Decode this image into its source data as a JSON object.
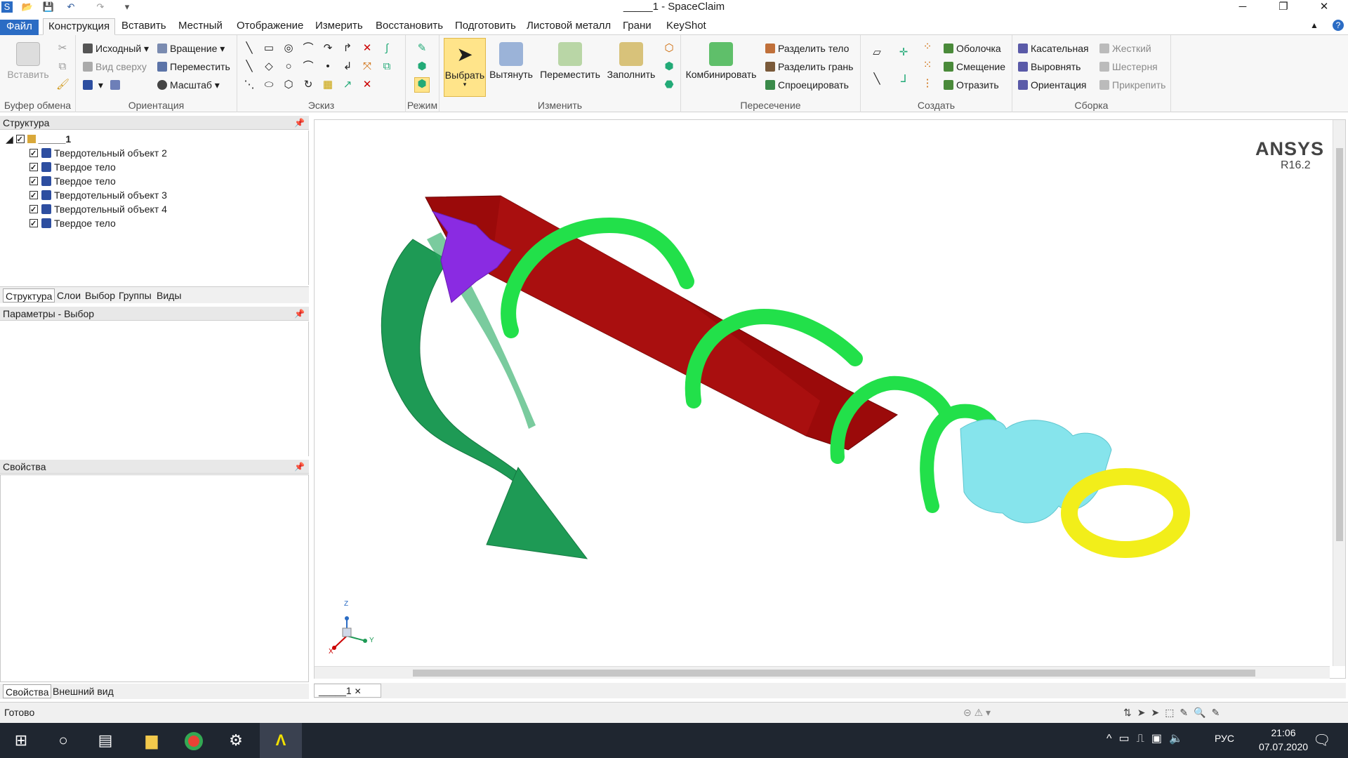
{
  "window": {
    "title": "_____1 - SpaceClaim"
  },
  "menu": {
    "file": "Файл",
    "tabs": [
      "Конструкция",
      "Вставить",
      "Местный",
      "Отображение",
      "Измерить",
      "Восстановить",
      "Подготовить",
      "Листовой металл",
      "Грани",
      "KeyShot"
    ]
  },
  "ribbon": {
    "clipboard": {
      "paste": "Вставить",
      "label": "Буфер обмена"
    },
    "orientation": {
      "home": "Исходный",
      "rotate": "Вращение",
      "top_view": "Вид сверху",
      "pan": "Переместить",
      "zoom": "Масштаб",
      "label": "Ориентация"
    },
    "sketch": {
      "label": "Эскиз"
    },
    "mode": {
      "label": "Режим"
    },
    "edit": {
      "select": "Выбрать",
      "pull": "Вытянуть",
      "move": "Переместить",
      "fill": "Заполнить",
      "label": "Изменить"
    },
    "intersect": {
      "combine": "Комбинировать",
      "split_body": "Разделить тело",
      "split_face": "Разделить грань",
      "project": "Спроецировать",
      "label": "Пересечение"
    },
    "create": {
      "shell": "Оболочка",
      "offset": "Смещение",
      "mirror": "Отразить",
      "label": "Создать"
    },
    "assembly": {
      "tangent": "Касательная",
      "align": "Выровнять",
      "orient": "Ориентация",
      "rigid": "Жесткий",
      "gear": "Шестерня",
      "anchor": "Прикрепить",
      "label": "Сборка"
    }
  },
  "structure": {
    "title": "Структура",
    "root": "_____1",
    "items": [
      "Твердотельный объект 2",
      "Твердое тело",
      "Твердое тело",
      "Твердотельный объект 3",
      "Твердотельный объект 4",
      "Твердое тело"
    ],
    "tabs": [
      "Структура",
      "Слои",
      "Выбор",
      "Группы",
      "Виды"
    ]
  },
  "options_panel": {
    "title": "Параметры - Выбор"
  },
  "properties_panel": {
    "title": "Свойства",
    "tabs": [
      "Свойства",
      "Внешний вид"
    ]
  },
  "viewport": {
    "brand": "ANSYS",
    "version": "R16.2",
    "doc_tab": "_____1",
    "axes": {
      "x": "X",
      "y": "Y",
      "z": "Z"
    }
  },
  "status": {
    "text": "Готово"
  },
  "taskbar": {
    "lang": "РУС",
    "time": "21:06",
    "date": "07.07.2020"
  },
  "colors": {
    "accent": "#2b6cc4",
    "red_body": "#9b0a0a",
    "green_spring": "#22e04a",
    "green_arrow": "#1e9a55",
    "cyan_body": "#86e4ec",
    "yellow_ring": "#f2ee1a",
    "purple": "#8a2be2"
  }
}
